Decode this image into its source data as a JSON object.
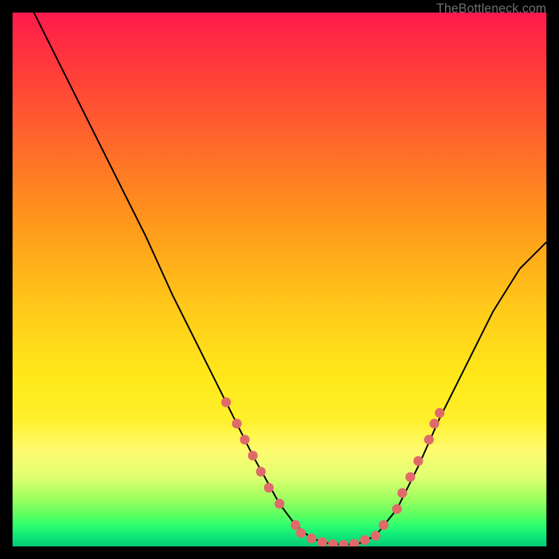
{
  "watermark": {
    "text": "TheBottleneck.com"
  },
  "chart_data": {
    "type": "line",
    "title": "",
    "xlabel": "",
    "ylabel": "",
    "xlim": [
      0,
      100
    ],
    "ylim": [
      0,
      100
    ],
    "grid": false,
    "legend": false,
    "series": [
      {
        "name": "bottleneck-curve",
        "color": "#000000",
        "x": [
          4,
          10,
          15,
          20,
          25,
          30,
          35,
          40,
          45,
          50,
          53,
          56,
          59,
          62,
          65,
          68,
          72,
          76,
          80,
          85,
          90,
          95,
          100
        ],
        "y": [
          100,
          88,
          78,
          68,
          58,
          47,
          37,
          27,
          17,
          8,
          4,
          1.5,
          0.6,
          0.3,
          0.6,
          2,
          7,
          15,
          24,
          34,
          44,
          52,
          57
        ]
      }
    ],
    "markers": [
      {
        "name": "highlight-points",
        "color": "#e06a6a",
        "radius": 7,
        "points": [
          {
            "x": 40,
            "y": 27
          },
          {
            "x": 42,
            "y": 23
          },
          {
            "x": 43.5,
            "y": 20
          },
          {
            "x": 45,
            "y": 17
          },
          {
            "x": 46.5,
            "y": 14
          },
          {
            "x": 48,
            "y": 11
          },
          {
            "x": 50,
            "y": 8
          },
          {
            "x": 53,
            "y": 4
          },
          {
            "x": 54,
            "y": 2.5
          },
          {
            "x": 56,
            "y": 1.5
          },
          {
            "x": 58,
            "y": 0.8
          },
          {
            "x": 60,
            "y": 0.4
          },
          {
            "x": 62,
            "y": 0.3
          },
          {
            "x": 64,
            "y": 0.5
          },
          {
            "x": 66,
            "y": 1.2
          },
          {
            "x": 68,
            "y": 2
          },
          {
            "x": 69.5,
            "y": 4
          },
          {
            "x": 72,
            "y": 7
          },
          {
            "x": 73,
            "y": 10
          },
          {
            "x": 74.5,
            "y": 13
          },
          {
            "x": 76,
            "y": 16
          },
          {
            "x": 78,
            "y": 20
          },
          {
            "x": 79,
            "y": 23
          },
          {
            "x": 80,
            "y": 25
          }
        ]
      }
    ]
  }
}
